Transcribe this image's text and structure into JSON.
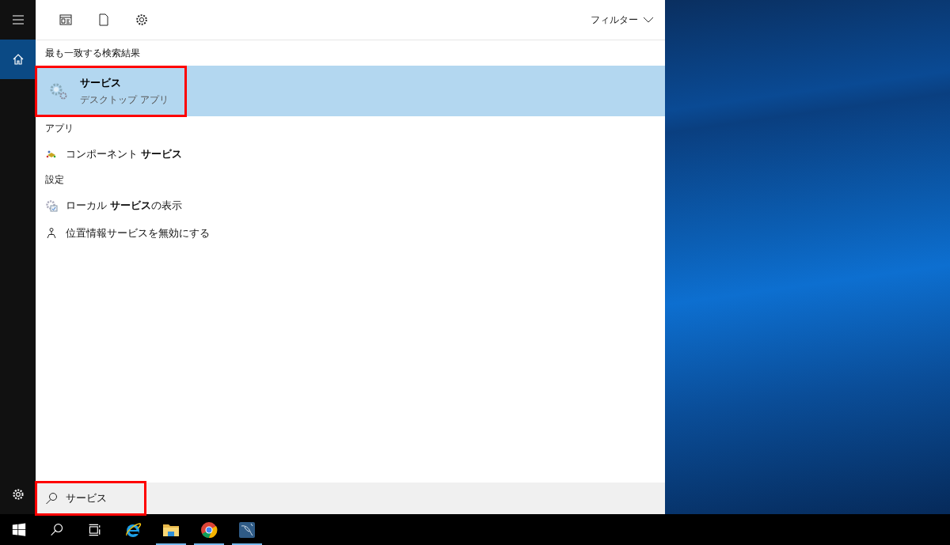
{
  "nav": [
    {
      "kind": "menu",
      "selected": false
    },
    {
      "kind": "home",
      "selected": true
    }
  ],
  "nav_bottom": [
    {
      "kind": "settings",
      "selected": false
    }
  ],
  "toolbar": {
    "filter": "フィルター"
  },
  "best_match": {
    "heading": "最も一致する検索結果",
    "title": "サービス",
    "subtitle": "デスクトップ アプリ",
    "selected": true,
    "highlighted": true
  },
  "sections": [
    {
      "heading": "アプリ",
      "items": [
        {
          "kind": "component",
          "text": "コンポーネント **サービス**"
        }
      ]
    },
    {
      "heading": "設定",
      "items": [
        {
          "kind": "local-services",
          "text": "ローカル **サービス**の表示"
        },
        {
          "kind": "location",
          "text": "位置情報サービスを無効にする"
        }
      ]
    }
  ],
  "search": {
    "value": "サービス",
    "highlighted": true
  },
  "taskbar": [
    {
      "kind": "ie",
      "running": false
    },
    {
      "kind": "folder",
      "running": true
    },
    {
      "kind": "chrome",
      "running": true
    },
    {
      "kind": "dolphin",
      "running": true
    }
  ]
}
